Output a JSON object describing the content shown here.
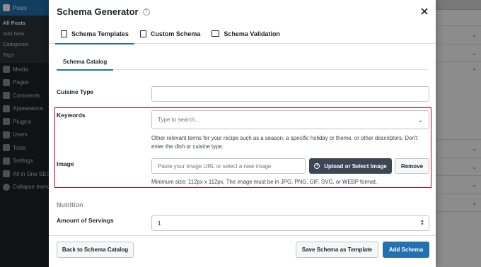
{
  "wp_sidebar": {
    "menu_head": "Posts",
    "sub_items": [
      "All Posts",
      "Add New",
      "Categories",
      "Tags"
    ],
    "menu_items": [
      "Media",
      "Pages",
      "Comments",
      "Appearance",
      "Plugins",
      "Users",
      "Tools",
      "Settings",
      "All in One SEO",
      "Collapse menu"
    ]
  },
  "modal": {
    "title": "Schema Generator",
    "tabs": [
      {
        "label": "Schema Templates",
        "icon": "document-icon"
      },
      {
        "label": "Custom Schema",
        "icon": "code-file-icon"
      },
      {
        "label": "Schema Validation",
        "icon": "terminal-icon"
      }
    ],
    "subtab": "Schema Catalog",
    "fields": {
      "cuisine_type": {
        "label": "Cuisine Type",
        "value": ""
      },
      "keywords": {
        "label": "Keywords",
        "placeholder": "Type to search...",
        "description_line1": "Other relevant terms for your recipe such as a season, a specific holiday or theme, or other descriptors. Don't",
        "description_line2": "enter the dish or cuisine type."
      },
      "image": {
        "label": "Image",
        "placeholder": "Paste your image URL or select a new image",
        "upload_button": "Upload or Select Image",
        "remove_button": "Remove",
        "hint": "Minimum size: 112px x 112px, The image must be in JPG, PNG, GIF, SVG, or WEBP format."
      },
      "nutrition_title": "Nutrition",
      "servings": {
        "label": "Amount of Servings",
        "value": "1"
      }
    },
    "footer": {
      "back_button": "Back to Schema Catalog",
      "save_template_button": "Save Schema as Template",
      "add_button": "Add Schema"
    }
  },
  "colors": {
    "accent": "#2271b1",
    "highlight_border": "#d0021b",
    "sidebar_bg": "#1d2327",
    "dark_button": "#3c4655"
  }
}
